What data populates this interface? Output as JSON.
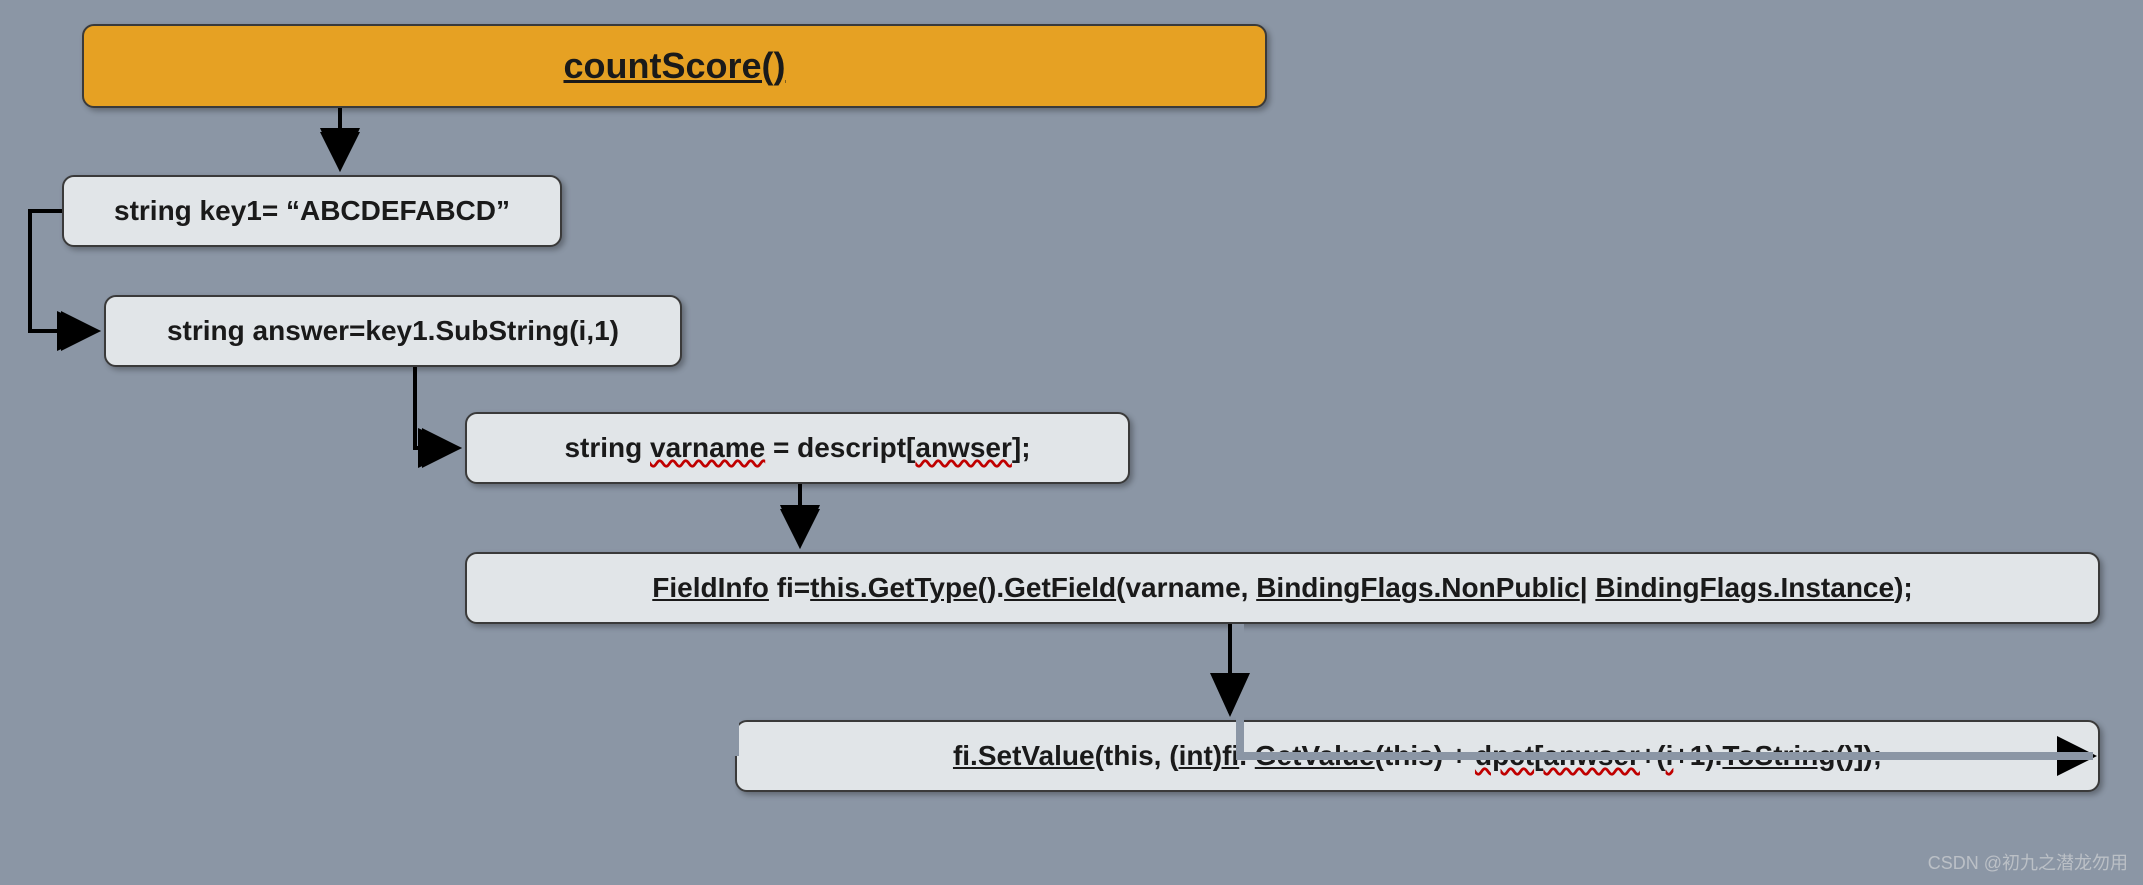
{
  "title": "countScore()",
  "steps": {
    "s1": "string key1= “ABCDEFABCD”",
    "s2": "string answer=key1.SubString(i,1)",
    "s3_pre": "string ",
    "s3_var": "varname",
    "s3_mid": " = descript[",
    "s3_arg": "anwser",
    "s3_post": "];",
    "s4_a": "FieldInfo",
    "s4_b": " fi=",
    "s4_c": "this.GetType",
    "s4_d": "().",
    "s4_e": "GetField",
    "s4_f": "(varname, ",
    "s4_g": "BindingFlags.NonPublic",
    "s4_h": "| ",
    "s4_i": "BindingFlags.Instance",
    "s4_j": ");",
    "s5_a": "fi.SetValue",
    "s5_b": "(this, (",
    "s5_c": "int)fi",
    "s5_d": ". ",
    "s5_e": "GetValue",
    "s5_f": "(this) + ",
    "s5_g": "dpct",
    "s5_h": "[",
    "s5_i": "anwser",
    "s5_j": "+(",
    "s5_k": "i",
    "s5_l": "+1).",
    "s5_m": "ToString",
    "s5_n": "()]);"
  },
  "watermark": "CSDN @初九之潜龙勿用"
}
